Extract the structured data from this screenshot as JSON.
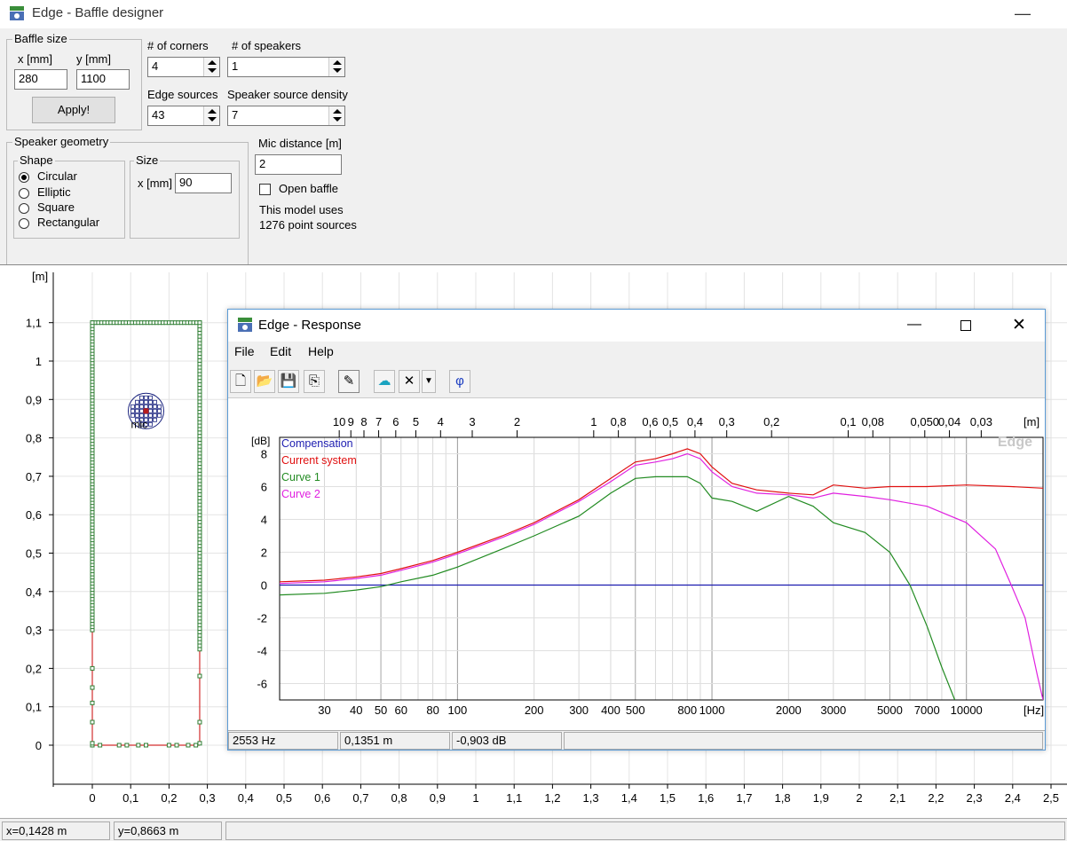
{
  "window": {
    "title": "Edge - Baffle designer",
    "min_icon": "minimize-icon"
  },
  "baffle_size": {
    "group": "Baffle size",
    "x_label": "x [mm]",
    "y_label": "y [mm]",
    "x_value": "280",
    "y_value": "1100",
    "apply": "Apply!"
  },
  "corners": {
    "label": "# of corners",
    "value": "4"
  },
  "speakers": {
    "label": "# of speakers",
    "value": "1"
  },
  "edge_sources": {
    "label": "Edge sources",
    "value": "43"
  },
  "speaker_density": {
    "label": "Speaker source density",
    "value": "7"
  },
  "geometry": {
    "group": "Speaker geometry",
    "shape_group": "Shape",
    "shapes": [
      "Circular",
      "Elliptic",
      "Square",
      "Rectangular"
    ],
    "selected": "Circular",
    "size_group": "Size",
    "size_x_label": "x [mm]",
    "size_x_value": "90"
  },
  "mic": {
    "label": "Mic distance [m]",
    "value": "2",
    "open_baffle": "Open baffle",
    "open_baffle_checked": false,
    "model_info_1": "This model uses",
    "model_info_2": "1276 point sources"
  },
  "baffle_plot": {
    "unit_label": "[m]",
    "y_ticks": [
      "1,1",
      "1",
      "0,9",
      "0,8",
      "0,7",
      "0,6",
      "0,5",
      "0,4",
      "0,3",
      "0,2",
      "0,1",
      "0"
    ],
    "x_ticks": [
      "0",
      "0,1",
      "0,2",
      "0,3",
      "0,4",
      "0,5",
      "0,6",
      "0,7",
      "0,8",
      "0,9",
      "1",
      "1,1",
      "1,2",
      "1,3",
      "1,4",
      "1,5",
      "1,6",
      "1,7",
      "1,8",
      "1,9",
      "2",
      "2,1",
      "2,2",
      "2,3",
      "2,4",
      "2,5"
    ],
    "mic_label": "mic",
    "colors": {
      "edge": "#2e7d32",
      "edge_line": "#d32f2f",
      "speaker": "#1a237e",
      "mic": "#b71c1c"
    }
  },
  "status": {
    "x": "x=0,1428 m",
    "y": "y=0,8663 m"
  },
  "response": {
    "title": "Edge - Response",
    "menu": [
      "File",
      "Edit",
      "Help"
    ],
    "toolbar_icons": [
      "new-file-icon",
      "open-folder-icon",
      "save-icon",
      "copy-icon",
      "pen-icon",
      "speaker-icon",
      "delete-icon",
      "dropdown-arrow-icon",
      "phase-icon"
    ],
    "phase_glyph": "φ",
    "status": {
      "freq": "2553 Hz",
      "dist": "0,1351 m",
      "db": "-0,903 dB"
    },
    "watermark": "Edge"
  },
  "chart_data": {
    "type": "line",
    "xlabel": "[Hz]",
    "ylabel": "[dB]",
    "top_axis_label": "[m]",
    "x_scale": "log",
    "xlim": [
      20,
      20000
    ],
    "ylim": [
      -7,
      9
    ],
    "x_ticks": [
      {
        "v": 30,
        "t": "30"
      },
      {
        "v": 40,
        "t": "40"
      },
      {
        "v": 50,
        "t": "50"
      },
      {
        "v": 60,
        "t": "60"
      },
      {
        "v": 80,
        "t": "80"
      },
      {
        "v": 100,
        "t": "100"
      },
      {
        "v": 200,
        "t": "200"
      },
      {
        "v": 300,
        "t": "300"
      },
      {
        "v": 400,
        "t": "400"
      },
      {
        "v": 500,
        "t": "500"
      },
      {
        "v": 800,
        "t": "800"
      },
      {
        "v": 1000,
        "t": "1000"
      },
      {
        "v": 2000,
        "t": "2000"
      },
      {
        "v": 3000,
        "t": "3000"
      },
      {
        "v": 5000,
        "t": "5000"
      },
      {
        "v": 7000,
        "t": "7000"
      },
      {
        "v": 10000,
        "t": "10000"
      }
    ],
    "top_ticks": [
      {
        "v": 34.3,
        "t": "10"
      },
      {
        "v": 38.1,
        "t": "9"
      },
      {
        "v": 42.9,
        "t": "8"
      },
      {
        "v": 49,
        "t": "7"
      },
      {
        "v": 57.2,
        "t": "6"
      },
      {
        "v": 68.6,
        "t": "5"
      },
      {
        "v": 85.8,
        "t": "4"
      },
      {
        "v": 114.3,
        "t": "3"
      },
      {
        "v": 171.5,
        "t": "2"
      },
      {
        "v": 343,
        "t": "1"
      },
      {
        "v": 428.8,
        "t": "0,8"
      },
      {
        "v": 571.7,
        "t": "0,6"
      },
      {
        "v": 686,
        "t": "0,5"
      },
      {
        "v": 857.5,
        "t": "0,4"
      },
      {
        "v": 1143,
        "t": "0,3"
      },
      {
        "v": 1715,
        "t": "0,2"
      },
      {
        "v": 3430,
        "t": "0,1"
      },
      {
        "v": 4288,
        "t": "0,08"
      },
      {
        "v": 6860,
        "t": "0,050"
      },
      {
        "v": 8575,
        "t": "0,04"
      },
      {
        "v": 11433,
        "t": "0,03"
      }
    ],
    "y_ticks": [
      8,
      6,
      4,
      2,
      0,
      -2,
      -4,
      -6
    ],
    "grid": true,
    "legend_position": "top-left",
    "series": [
      {
        "name": "Compensation",
        "color": "#1c1cb0",
        "x": [
          20,
          20000
        ],
        "y": [
          0,
          0
        ]
      },
      {
        "name": "Current system",
        "color": "#e01010",
        "x": [
          20,
          30,
          40,
          50,
          60,
          80,
          100,
          150,
          200,
          300,
          400,
          500,
          600,
          700,
          800,
          900,
          1000,
          1200,
          1500,
          2000,
          2500,
          3000,
          4000,
          5000,
          7000,
          10000,
          15000,
          20000
        ],
        "y": [
          0.2,
          0.3,
          0.5,
          0.7,
          1.0,
          1.5,
          2.0,
          3.0,
          3.8,
          5.2,
          6.5,
          7.5,
          7.7,
          8.0,
          8.3,
          8.0,
          7.2,
          6.2,
          5.8,
          5.6,
          5.5,
          6.1,
          5.9,
          6.0,
          6.0,
          6.1,
          6.0,
          5.9
        ]
      },
      {
        "name": "Curve 1",
        "color": "#228b22",
        "x": [
          20,
          30,
          40,
          50,
          60,
          80,
          100,
          150,
          200,
          300,
          400,
          500,
          600,
          700,
          800,
          900,
          1000,
          1200,
          1500,
          2000,
          2500,
          3000,
          4000,
          5000,
          6000,
          7000,
          8000,
          9000
        ],
        "y": [
          -0.6,
          -0.5,
          -0.3,
          -0.1,
          0.2,
          0.6,
          1.1,
          2.2,
          3.0,
          4.2,
          5.6,
          6.5,
          6.6,
          6.6,
          6.6,
          6.2,
          5.3,
          5.1,
          4.5,
          5.4,
          4.8,
          3.8,
          3.2,
          2.0,
          0.0,
          -2.5,
          -5.0,
          -7.0
        ]
      },
      {
        "name": "Curve 2",
        "color": "#e020e0",
        "x": [
          20,
          30,
          40,
          50,
          60,
          80,
          100,
          150,
          200,
          300,
          400,
          500,
          600,
          700,
          800,
          900,
          1000,
          1200,
          1500,
          2000,
          2500,
          3000,
          4000,
          5000,
          7000,
          10000,
          13000,
          15000,
          17000,
          19000,
          20000
        ],
        "y": [
          0.1,
          0.2,
          0.4,
          0.6,
          0.9,
          1.4,
          1.9,
          2.9,
          3.7,
          5.1,
          6.3,
          7.3,
          7.5,
          7.7,
          8.0,
          7.7,
          6.9,
          6.0,
          5.6,
          5.5,
          5.3,
          5.6,
          5.4,
          5.2,
          4.8,
          3.8,
          2.2,
          0.0,
          -2.0,
          -5.5,
          -7.0
        ]
      }
    ]
  }
}
